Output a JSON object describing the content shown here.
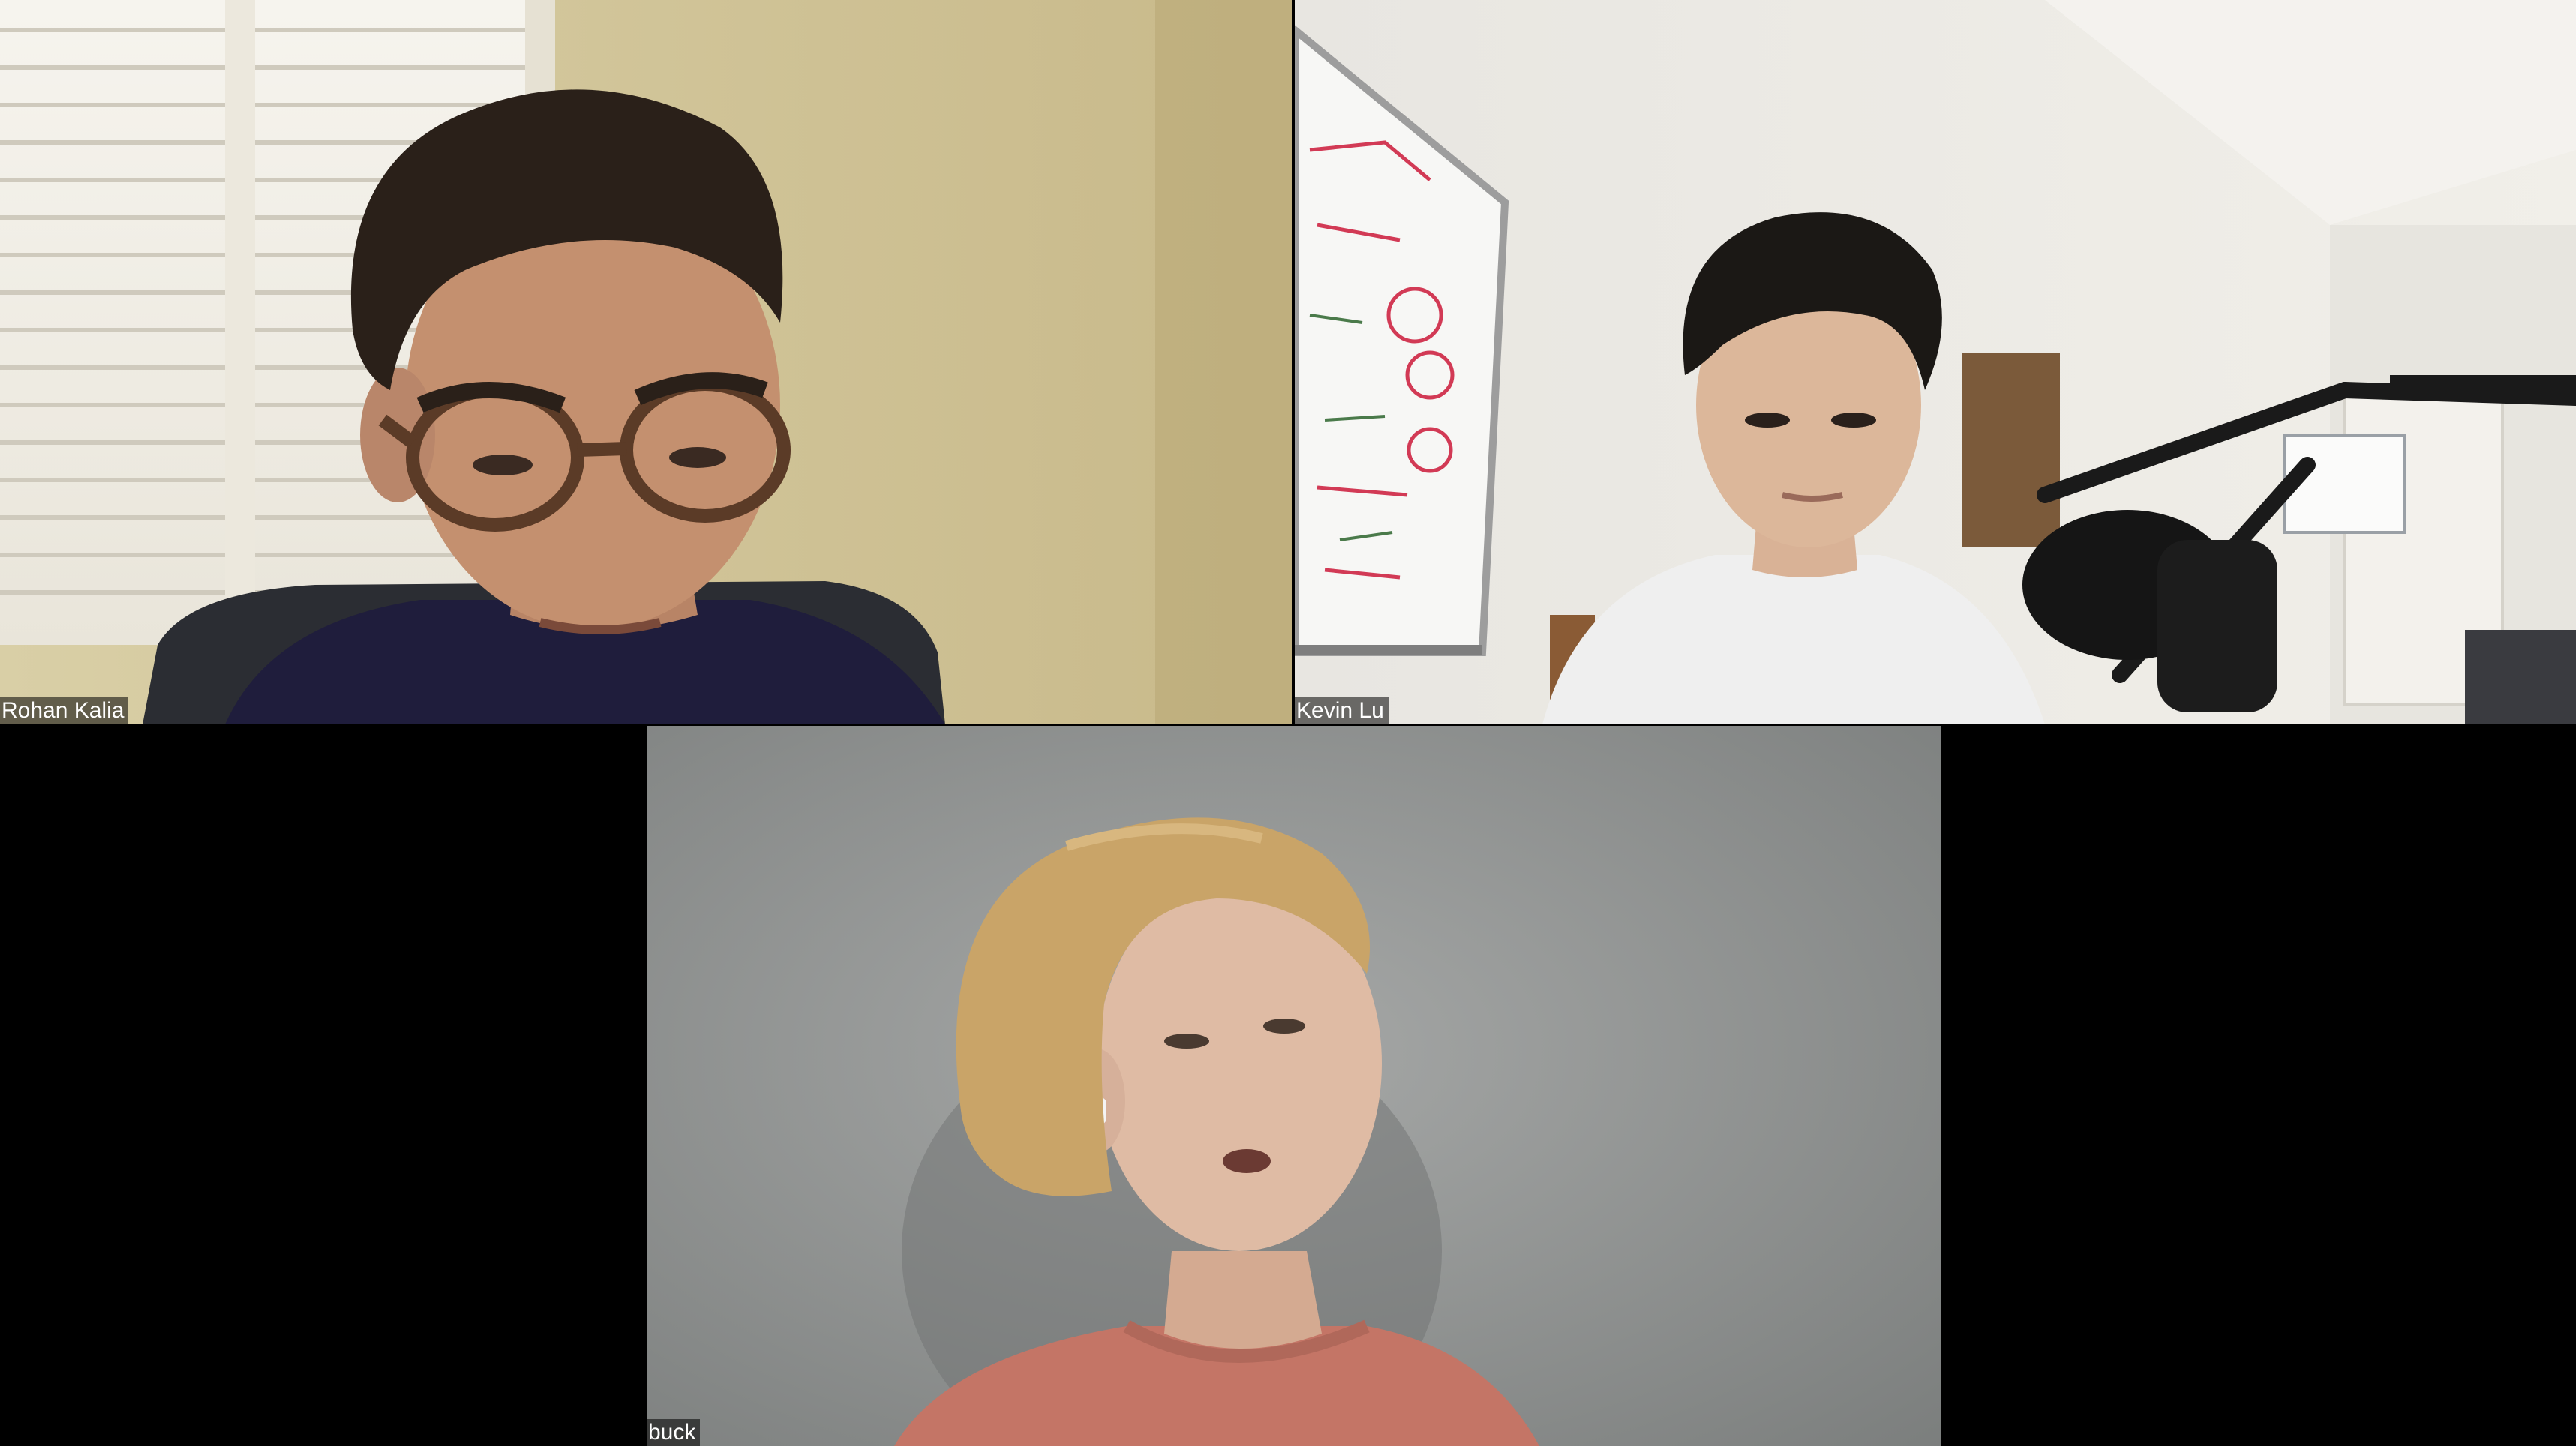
{
  "meeting": {
    "layout": "gallery",
    "participants": [
      {
        "name": "Rohan Kalia"
      },
      {
        "name": "Kevin Lu"
      },
      {
        "name": "buck"
      }
    ]
  },
  "colors": {
    "background": "#000000",
    "name_tag_text": "#ffffff"
  }
}
